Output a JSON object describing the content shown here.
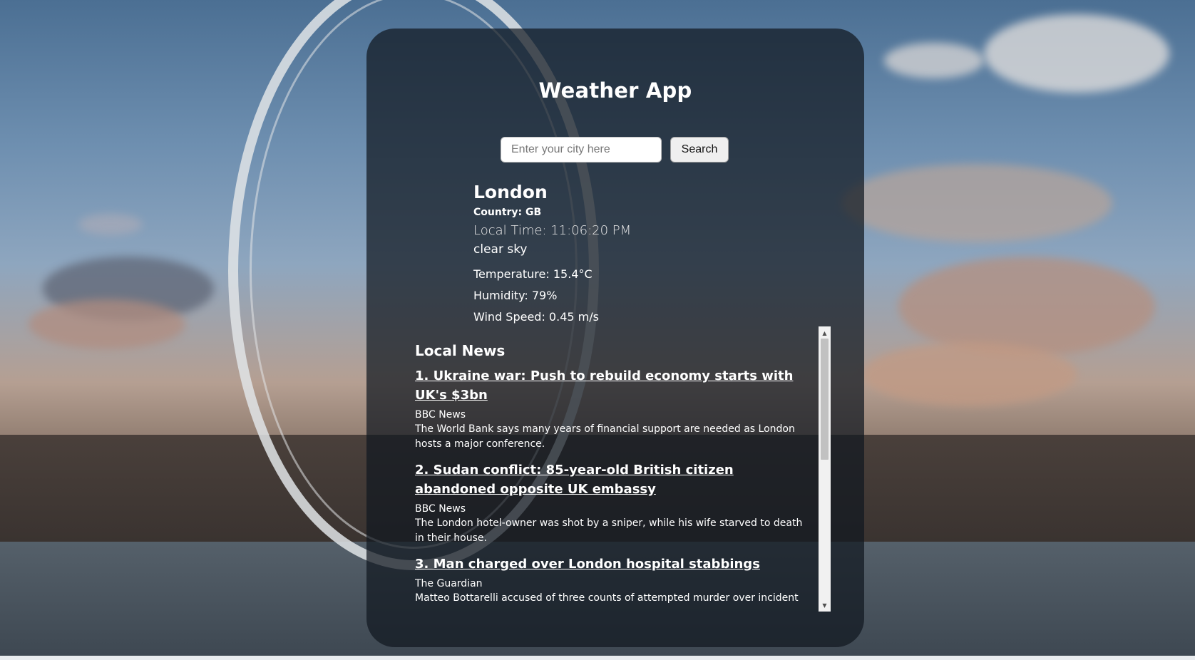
{
  "app": {
    "title": "Weather App"
  },
  "search": {
    "placeholder": "Enter your city here",
    "value": "",
    "button_label": "Search"
  },
  "weather": {
    "city": "London",
    "country": "Country: GB",
    "local_time": "Local Time: 11:06:20 PM",
    "description": "clear sky",
    "temperature": "Temperature: 15.4°C",
    "humidity": "Humidity: 79%",
    "wind_speed": "Wind Speed: 0.45 m/s"
  },
  "news": {
    "heading": "Local News",
    "items": [
      {
        "title": "1. Ukraine war: Push to rebuild economy starts with UK's $3bn",
        "source": "BBC News",
        "description": "The World Bank says many years of financial support are needed as London hosts a major conference."
      },
      {
        "title": "2. Sudan conflict: 85-year-old British citizen abandoned opposite UK embassy",
        "source": "BBC News",
        "description": "The London hotel-owner was shot by a sniper, while his wife starved to death in their house."
      },
      {
        "title": "3. Man charged over London hospital stabbings",
        "source": "The Guardian",
        "description": "Matteo Bottarelli accused of three counts of attempted murder over incident"
      }
    ]
  },
  "colors": {
    "card_background": "#111820",
    "text": "#ffffff",
    "scrollbar_track": "#f1f1f1",
    "scrollbar_thumb": "#c1c1c1"
  },
  "icons": {
    "scroll_up": "scroll-up-arrow-icon",
    "scroll_down": "scroll-down-arrow-icon"
  }
}
